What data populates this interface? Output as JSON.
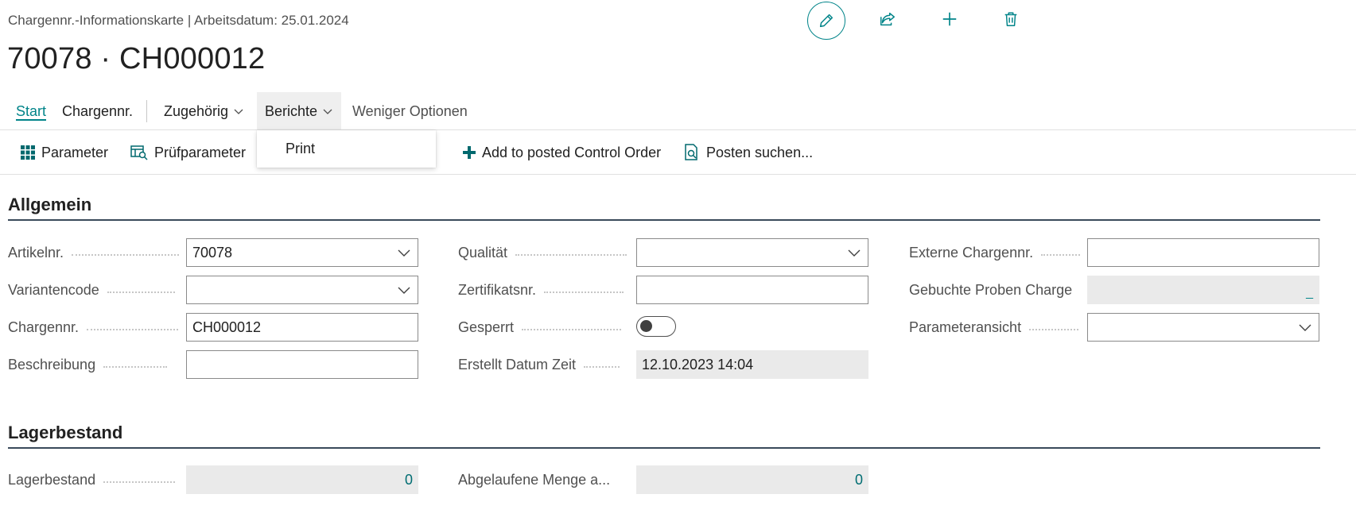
{
  "header": {
    "breadcrumb": "Chargennr.-Informationskarte | Arbeitsdatum: 25.01.2024",
    "title": "70078 · CH000012",
    "actions": [
      "pencil-icon",
      "share-icon",
      "plus-icon",
      "trash-icon"
    ]
  },
  "tabs": {
    "start": "Start",
    "chargennr": "Chargennr.",
    "zugehoerig": "Zugehörig",
    "berichte": "Berichte",
    "weniger": "Weniger Optionen"
  },
  "toolbar": {
    "parameter": "Parameter",
    "pruefparameter": "Prüfparameter",
    "add_control_order": "Add to posted Control Order",
    "posten_suchen": "Posten suchen..."
  },
  "dropdown": {
    "print": "Print"
  },
  "allgemein": {
    "title": "Allgemein",
    "artikelnr_label": "Artikelnr.",
    "artikelnr_value": "70078",
    "variantencode_label": "Variantencode",
    "variantencode_value": "",
    "chargennr_label": "Chargennr.",
    "chargennr_value": "CH000012",
    "beschreibung_label": "Beschreibung",
    "beschreibung_value": "",
    "qualitaet_label": "Qualität",
    "qualitaet_value": "",
    "zertifikatsnr_label": "Zertifikatsnr.",
    "zertifikatsnr_value": "",
    "gesperrt_label": "Gesperrt",
    "gesperrt_value": false,
    "erstellt_label": "Erstellt Datum Zeit",
    "erstellt_value": "12.10.2023 14:04",
    "externe_label": "Externe Chargennr.",
    "externe_value": "",
    "gebuchte_label": "Gebuchte Proben Charge",
    "gebuchte_value": "_",
    "parameteransicht_label": "Parameteransicht",
    "parameteransicht_value": ""
  },
  "lagerbestand": {
    "title": "Lagerbestand",
    "lagerbestand_label": "Lagerbestand",
    "lagerbestand_value": "0",
    "abgelaufene_label": "Abgelaufene Menge a...",
    "abgelaufene_value": "0"
  },
  "colors": {
    "accent": "#008489",
    "text": "#212121",
    "muted": "#505050",
    "readonly_bg": "#eaeaea"
  }
}
